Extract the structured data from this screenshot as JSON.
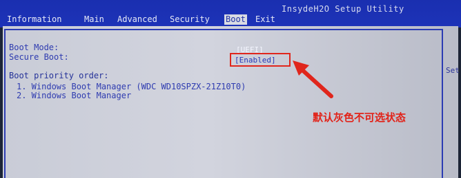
{
  "header": {
    "utility_title": "InsydeH2O Setup Utility",
    "tabs": [
      {
        "label": "Information"
      },
      {
        "label": "Main"
      },
      {
        "label": "Advanced"
      },
      {
        "label": "Security"
      },
      {
        "label": "Boot"
      },
      {
        "label": "Exit"
      }
    ],
    "active_tab": "Boot"
  },
  "boot": {
    "boot_mode_label": "Boot Mode:",
    "boot_mode_value": "[UEFI]",
    "secure_boot_label": "Secure Boot:",
    "secure_boot_value": "[Enabled]",
    "priority_label": "Boot priority order:",
    "priority_items": [
      "1. Windows Boot Manager (WDC WD10SPZX-21Z10T0)",
      "2. Windows Boot Manager"
    ]
  },
  "help_panel": {
    "text": "Set"
  },
  "annotation": {
    "text": "默认灰色不可选状态",
    "color": "#e22218"
  }
}
